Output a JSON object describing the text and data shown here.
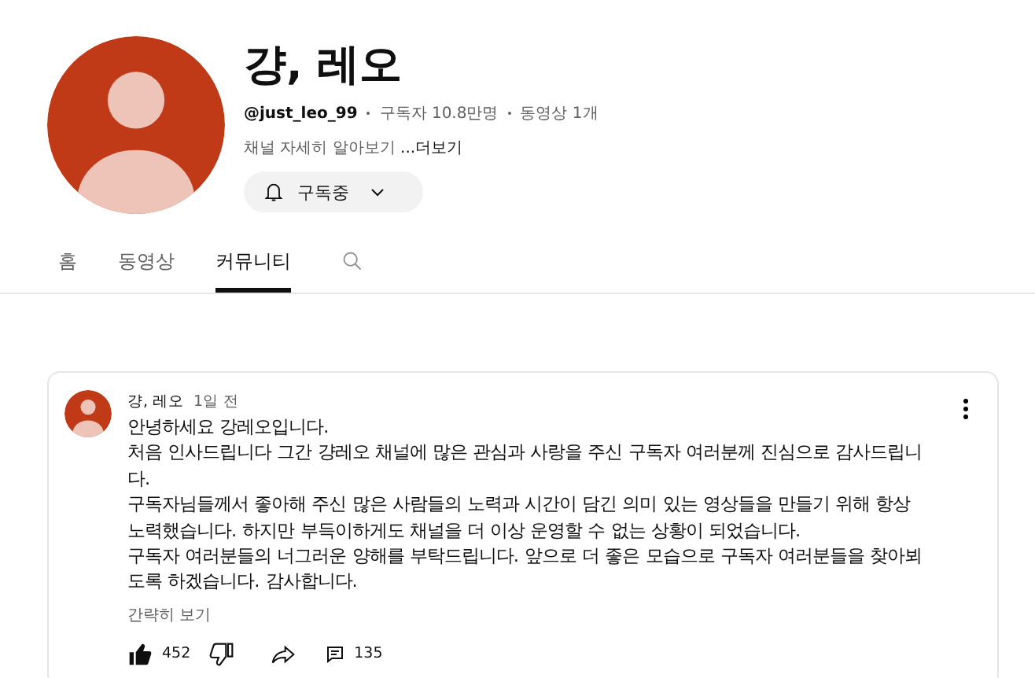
{
  "channel": {
    "name": "걍, 레오",
    "handle": "@just_leo_99",
    "subscribers": "구독자 10.8만명",
    "videos": "동영상 1개",
    "description": "채널 자세히 알아보기 ",
    "more": "...더보기",
    "subscribe_button": "구독중"
  },
  "tabs": [
    {
      "label": "홈",
      "selected": false
    },
    {
      "label": "동영상",
      "selected": false
    },
    {
      "label": "커뮤니티",
      "selected": true
    }
  ],
  "post": {
    "author": "걍, 레오",
    "time": "1일 전",
    "paragraphs": [
      "안녕하세요 강레오입니다.",
      "처음 인사드립니다 그간 걍레오 채널에 많은 관심과 사랑을 주신 구독자 여러분께 진심으로 감사드립니다.",
      "구독자님들께서 좋아해 주신 많은 사람들의 노력과 시간이 담긴 의미 있는 영상들을 만들기 위해 항상 노력했습니다. 하지만 부득이하게도 채널을 더 이상 운영할 수 없는 상황이 되었습니다.",
      "구독자 여러분들의 너그러운 양해를 부탁드립니다. 앞으로 더 좋은 모습으로 구독자 여러분들을 찾아뵈도록 하겠습니다. 감사합니다."
    ],
    "show_less": "간략히 보기",
    "likes": "452",
    "comments": "135"
  }
}
